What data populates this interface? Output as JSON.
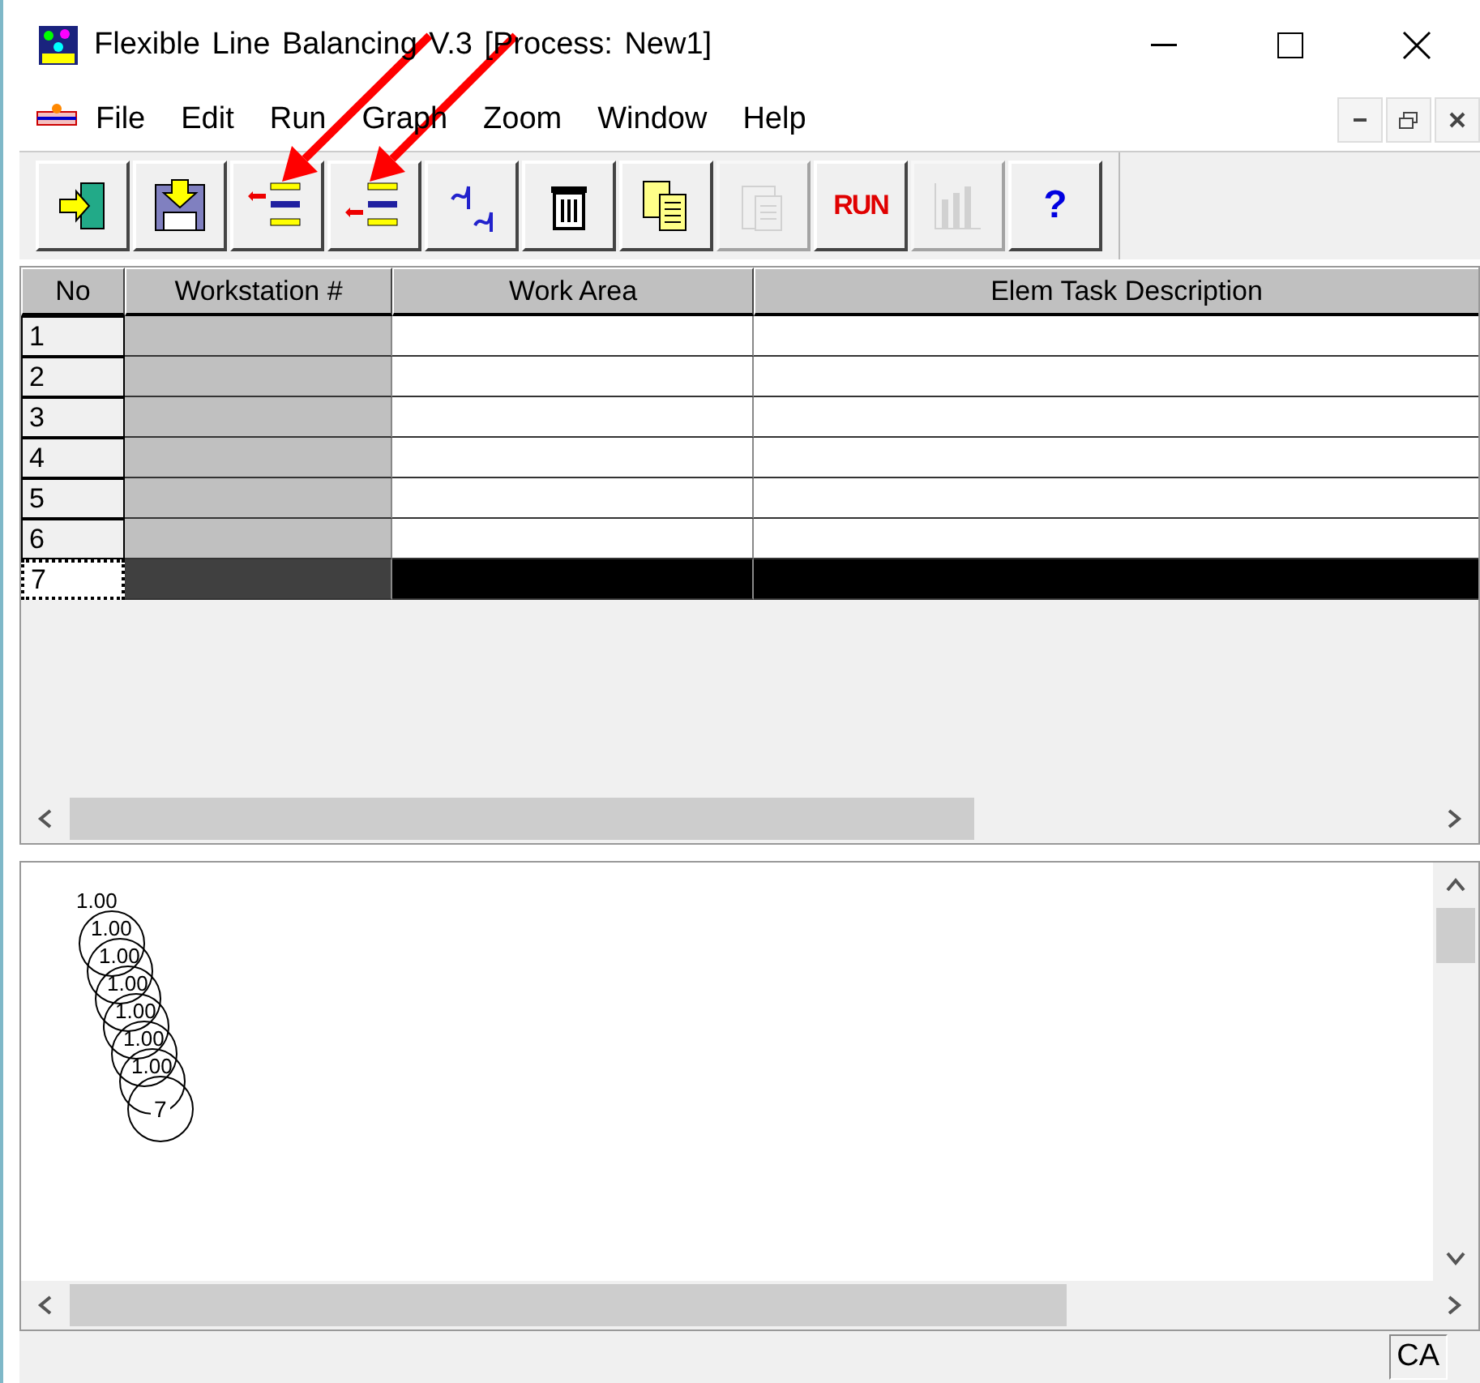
{
  "window": {
    "title": "Flexible Line Balancing V.3  [Process: New1]"
  },
  "menu": [
    "File",
    "Edit",
    "Run",
    "Graph",
    "Zoom",
    "Window",
    "Help"
  ],
  "toolbar": [
    {
      "kind": "exit",
      "disabled": false
    },
    {
      "kind": "save",
      "disabled": false
    },
    {
      "kind": "insert",
      "disabled": false
    },
    {
      "kind": "append",
      "disabled": false
    },
    {
      "kind": "graph",
      "disabled": false
    },
    {
      "kind": "delete",
      "disabled": false
    },
    {
      "kind": "copy",
      "disabled": false
    },
    {
      "kind": "paste",
      "disabled": true
    },
    {
      "kind": "run",
      "disabled": false,
      "label": "RUN"
    },
    {
      "kind": "chart",
      "disabled": true
    },
    {
      "kind": "help",
      "disabled": false,
      "label": "?"
    }
  ],
  "table": {
    "columns": [
      "No",
      "Workstation #",
      "Work Area",
      "Elem Task Description"
    ],
    "rows": [
      {
        "no": "1",
        "selected": false
      },
      {
        "no": "2",
        "selected": false
      },
      {
        "no": "3",
        "selected": false
      },
      {
        "no": "4",
        "selected": false
      },
      {
        "no": "5",
        "selected": false
      },
      {
        "no": "6",
        "selected": false
      },
      {
        "no": "7",
        "selected": true
      }
    ]
  },
  "graph": {
    "nodes": [
      {
        "weight": "1.00"
      },
      {
        "weight": "1.00"
      },
      {
        "weight": "1.00"
      },
      {
        "weight": "1.00"
      },
      {
        "weight": "1.00"
      },
      {
        "weight": "1.00"
      },
      {
        "weight": "1.00",
        "label": "7"
      }
    ]
  },
  "status_bar": {
    "panel": "CA"
  }
}
